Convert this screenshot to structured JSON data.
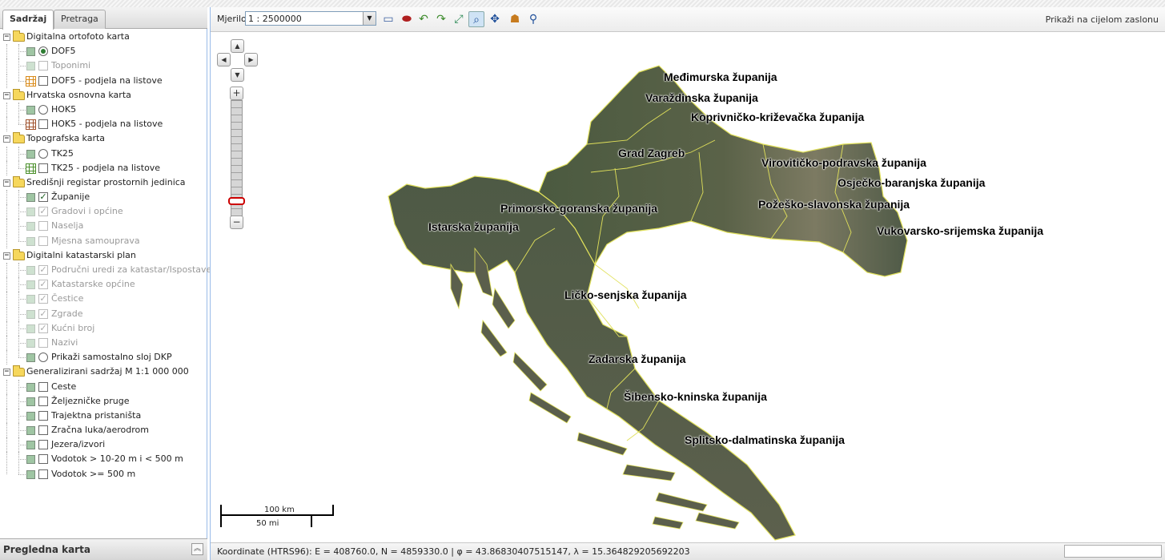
{
  "tabs": [
    {
      "label": "Sadržaj",
      "active": true
    },
    {
      "label": "Pretraga",
      "active": false
    }
  ],
  "layer_tree": [
    {
      "label": "Digitalna ortofoto karta",
      "children": [
        {
          "label": "DOF5",
          "control": "radio",
          "checked": true,
          "disabled": false,
          "icon": "layer-icon"
        },
        {
          "label": "Toponimi",
          "control": "checkbox",
          "checked": false,
          "disabled": true,
          "icon": "layer-icon"
        },
        {
          "label": "DOF5 - podjela na listove",
          "control": "checkbox",
          "checked": false,
          "disabled": false,
          "icon": "orange-grid-icon"
        }
      ]
    },
    {
      "label": "Hrvatska osnovna karta",
      "children": [
        {
          "label": "HOK5",
          "control": "radio",
          "checked": false,
          "disabled": false,
          "icon": "layer-icon"
        },
        {
          "label": "HOK5 - podjela na listove",
          "control": "checkbox",
          "checked": false,
          "disabled": false,
          "icon": "brown-grid-icon"
        }
      ]
    },
    {
      "label": "Topografska karta",
      "children": [
        {
          "label": "TK25",
          "control": "radio",
          "checked": false,
          "disabled": false,
          "icon": "layer-icon"
        },
        {
          "label": "TK25 - podjela na listove",
          "control": "checkbox",
          "checked": false,
          "disabled": false,
          "icon": "green-grid-icon"
        }
      ]
    },
    {
      "label": "Središnji registar prostornih jedinica",
      "children": [
        {
          "label": "Županije",
          "control": "checkbox",
          "checked": true,
          "disabled": false,
          "icon": "layer-icon"
        },
        {
          "label": "Gradovi i općine",
          "control": "checkbox",
          "checked": true,
          "disabled": true,
          "icon": "layer-icon"
        },
        {
          "label": "Naselja",
          "control": "checkbox",
          "checked": false,
          "disabled": true,
          "icon": "layer-icon"
        },
        {
          "label": "Mjesna samouprava",
          "control": "checkbox",
          "checked": false,
          "disabled": true,
          "icon": "layer-icon"
        }
      ]
    },
    {
      "label": "Digitalni katastarski plan",
      "children": [
        {
          "label": "Područni uredi za katastar/Ispostave",
          "control": "checkbox",
          "checked": true,
          "disabled": true,
          "icon": "layer-icon"
        },
        {
          "label": "Katastarske općine",
          "control": "checkbox",
          "checked": true,
          "disabled": true,
          "icon": "layer-icon"
        },
        {
          "label": "Čestice",
          "control": "checkbox",
          "checked": true,
          "disabled": true,
          "icon": "layer-icon"
        },
        {
          "label": "Zgrade",
          "control": "checkbox",
          "checked": true,
          "disabled": true,
          "icon": "layer-icon"
        },
        {
          "label": "Kućni broj",
          "control": "checkbox",
          "checked": true,
          "disabled": true,
          "icon": "layer-icon"
        },
        {
          "label": "Nazivi",
          "control": "checkbox",
          "checked": false,
          "disabled": true,
          "icon": "layer-icon"
        },
        {
          "label": "Prikaži samostalno sloj DKP",
          "control": "radio",
          "checked": false,
          "disabled": false,
          "icon": "layer-icon"
        }
      ]
    },
    {
      "label": "Generalizirani sadržaj M 1:1 000 000",
      "children": [
        {
          "label": "Ceste",
          "control": "checkbox",
          "checked": false,
          "disabled": false,
          "icon": "layer-icon"
        },
        {
          "label": "Željezničke pruge",
          "control": "checkbox",
          "checked": false,
          "disabled": false,
          "icon": "layer-icon"
        },
        {
          "label": "Trajektna pristaništa",
          "control": "checkbox",
          "checked": false,
          "disabled": false,
          "icon": "layer-icon"
        },
        {
          "label": "Zračna luka/aerodrom",
          "control": "checkbox",
          "checked": false,
          "disabled": false,
          "icon": "layer-icon"
        },
        {
          "label": "Jezera/izvori",
          "control": "checkbox",
          "checked": false,
          "disabled": false,
          "icon": "layer-icon"
        },
        {
          "label": "Vodotok > 10-20 m i < 500 m",
          "control": "checkbox",
          "checked": false,
          "disabled": false,
          "icon": "layer-icon"
        },
        {
          "label": "Vodotok >= 500 m",
          "control": "checkbox",
          "checked": false,
          "disabled": false,
          "icon": "layer-icon"
        }
      ]
    }
  ],
  "overview": {
    "title": "Pregledna karta",
    "collapse_icon": "double-chevron-up-icon"
  },
  "toolbar": {
    "scale_label": "Mjerilo",
    "scale_value": "1 : 2500000",
    "fullscreen_label": "Prikaži na cijelom zaslonu",
    "tools": [
      {
        "name": "measure-distance-icon",
        "glyph": "▭",
        "color": "#3a5fa0"
      },
      {
        "name": "measure-area-icon",
        "glyph": "⬬",
        "color": "#b02020"
      },
      {
        "name": "undo-icon",
        "glyph": "↶",
        "color": "#3b8a2a"
      },
      {
        "name": "redo-icon",
        "glyph": "↷",
        "color": "#3b8a2a"
      },
      {
        "name": "zoom-extent-icon",
        "glyph": "⤢",
        "color": "#2e8b57"
      },
      {
        "name": "zoom-box-icon",
        "glyph": "⌕",
        "color": "#1f4f9a",
        "selected": true
      },
      {
        "name": "pan-icon",
        "glyph": "✥",
        "color": "#1f4f9a"
      },
      {
        "name": "identify-icon",
        "glyph": "☗",
        "color": "#c77b1e"
      },
      {
        "name": "search-zoom-icon",
        "glyph": "⚲",
        "color": "#1f4f9a"
      }
    ]
  },
  "map": {
    "zoom_level": 3,
    "zoom_levels": 15,
    "scalebar": {
      "top_label": "100 km",
      "bottom_label": "50 mi"
    },
    "county_labels": [
      "Međimurska županija",
      "Varaždinska županija",
      "Koprivničko-križevačka županija",
      "Grad Zagreb",
      "Virovitičko-podravska županija",
      "Osječko-baranjska županija",
      "Požeško-slavonska županija",
      "Primorsko-goranska županija",
      "Vukovarsko-srijemska županija",
      "Istarska županija",
      "Ličko-senjska županija",
      "Zadarska županija",
      "Šibensko-kninska županija",
      "Splitsko-dalmatinska županija"
    ]
  },
  "status": {
    "coordinates": "Koordinate (HTRS96): E = 408760.0, N = 4859330.0 | φ = 43.86830407515147, λ = 15.364829205692203"
  },
  "colors": {
    "land_base": "#4f5b43",
    "land_border": "#e0e05a",
    "accent": "#99bbe8",
    "zoom_thumb": "#cc0000"
  }
}
